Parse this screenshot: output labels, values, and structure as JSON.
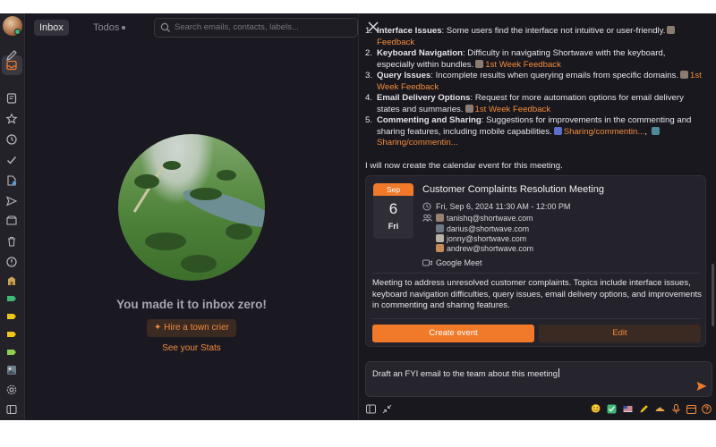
{
  "nav": {
    "tabs": [
      {
        "label": "Inbox",
        "active": true
      },
      {
        "label": "Todos",
        "active": false
      }
    ],
    "search_placeholder": "Search emails, contacts, labels..."
  },
  "inbox": {
    "empty_title": "You made it to inbox zero!",
    "crier_button": "Hire a town crier",
    "stats_link": "See your Stats"
  },
  "assistant": {
    "summary_items": [
      {
        "num": "1.",
        "title": "Interface Issues",
        "text": ": Some users find the interface not intuitive or user-friendly.",
        "refs": [
          "Feedback"
        ]
      },
      {
        "num": "2.",
        "title": "Keyboard Navigation",
        "text": ": Difficulty in navigating Shortwave with the keyboard, especially within bundles.",
        "refs": [
          "1st Week Feedback"
        ]
      },
      {
        "num": "3.",
        "title": "Query Issues",
        "text": ": Incomplete results when querying emails from specific domains.",
        "refs": [
          "1st Week Feedback"
        ]
      },
      {
        "num": "4.",
        "title": "Email Delivery Options",
        "text": ": Request for more automation options for email delivery states and summaries.",
        "refs": [
          "1st Week Feedback"
        ]
      },
      {
        "num": "5.",
        "title": "Commenting and Sharing",
        "text": ": Suggestions for improvements in the commenting and sharing features, including mobile capabilities.",
        "refs": [
          "Sharing/commentin...",
          "Sharing/commentin..."
        ]
      }
    ],
    "intro_text": "I will now create the calendar event for this meeting.",
    "event": {
      "month": "Sep",
      "day": "6",
      "weekday": "Fri",
      "title": "Customer Complaints Resolution Meeting",
      "datetime": "Fri, Sep 6, 2024 11:30 AM - 12:00 PM",
      "guests": [
        "tanishq@shortwave.com",
        "darius@shortwave.com",
        "jonny@shortwave.com",
        "andrew@shortwave.com"
      ],
      "location": "Google Meet",
      "description": "Meeting to address unresolved customer complaints. Topics include interface issues, keyboard navigation difficulties, query issues, email delivery options, and improvements in commenting and sharing features.",
      "create_label": "Create event",
      "edit_label": "Edit"
    },
    "composer_text": "Draft an FYI email to the team about this meeting"
  },
  "colors": {
    "accent": "#f07a2a",
    "background": "#1a1921",
    "text": "#e5e4ea"
  },
  "icons": [
    "compose-icon",
    "inbox-icon",
    "notes-icon",
    "star-icon",
    "clock-icon",
    "check-icon",
    "files-icon",
    "send-icon",
    "snooze-icon",
    "trash-icon",
    "alert-icon",
    "building-icon",
    "label-icon",
    "settings-icon",
    "sidebar-icon",
    "close-icon",
    "search-icon"
  ]
}
